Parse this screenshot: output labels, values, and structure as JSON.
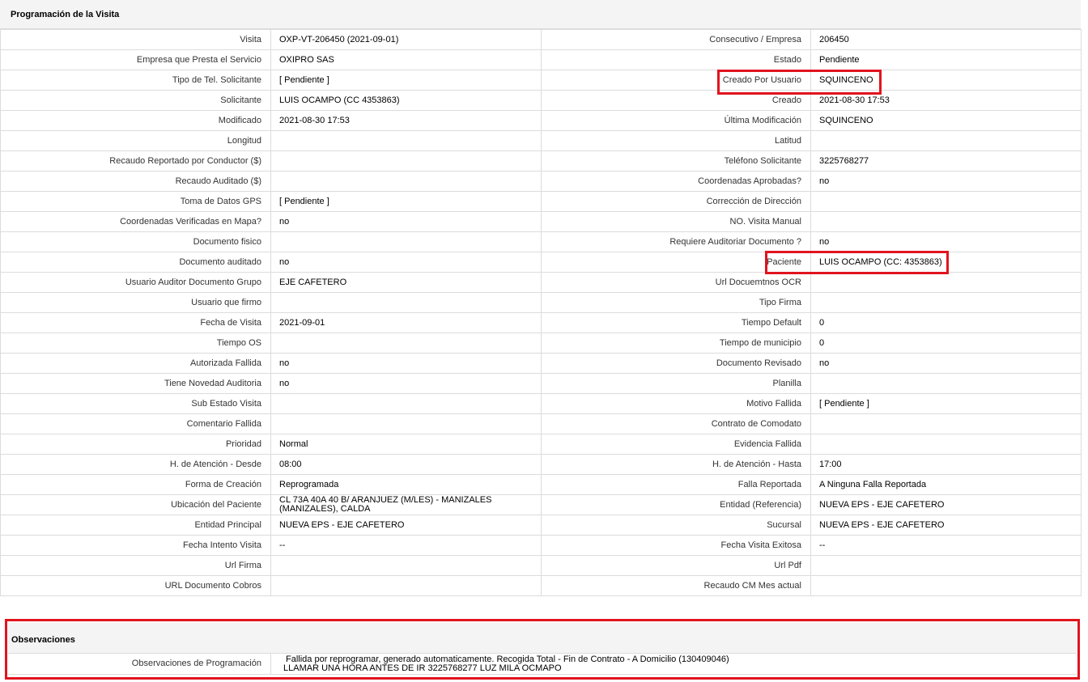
{
  "panel_title": "Programación de la Visita",
  "rows": [
    {
      "l1": "Visita",
      "v1": "OXP-VT-206450 (2021-09-01)",
      "l2": "Consecutivo / Empresa",
      "v2": "206450"
    },
    {
      "l1": "Empresa que Presta el Servicio",
      "v1": "OXIPRO SAS",
      "l2": "Estado",
      "v2": "Pendiente"
    },
    {
      "l1": "Tipo de Tel. Solicitante",
      "v1": "[ Pendiente ]",
      "l2": "Creado Por Usuario",
      "v2": "SQUINCENO"
    },
    {
      "l1": "Solicitante",
      "v1": "LUIS OCAMPO (CC 4353863)",
      "l2": "Creado",
      "v2": "2021-08-30 17:53"
    },
    {
      "l1": "Modificado",
      "v1": "2021-08-30 17:53",
      "l2": "Última Modificación",
      "v2": " SQUINCENO"
    },
    {
      "l1": "Longitud",
      "v1": "",
      "l2": "Latitud",
      "v2": ""
    },
    {
      "l1": "Recaudo Reportado por Conductor ($)",
      "v1": "",
      "l2": "Teléfono Solicitante",
      "v2": "3225768277"
    },
    {
      "l1": "Recaudo Auditado ($)",
      "v1": "",
      "l2": "Coordenadas Aprobadas?",
      "v2": " no"
    },
    {
      "l1": "Toma de Datos GPS",
      "v1": "[ Pendiente ]",
      "l2": "Corrección de Dirección",
      "v2": ""
    },
    {
      "l1": "Coordenadas Verificadas en Mapa?",
      "v1": " no",
      "l2": "NO. Visita Manual",
      "v2": ""
    },
    {
      "l1": "Documento fisico",
      "v1": "",
      "l2": "Requiere Auditoriar Documento ?",
      "v2": " no"
    },
    {
      "l1": "Documento auditado",
      "v1": " no",
      "l2": "Paciente",
      "v2": "LUIS OCAMPO (CC: 4353863)"
    },
    {
      "l1": "Usuario Auditor Documento Grupo",
      "v1": "EJE CAFETERO",
      "l2": "Url Docuemtnos OCR",
      "v2": ""
    },
    {
      "l1": "Usuario que firmo",
      "v1": "",
      "l2": "Tipo Firma",
      "v2": ""
    },
    {
      "l1": "Fecha de Visita",
      "v1": " 2021-09-01",
      "l2": "Tiempo Default",
      "v2": "0"
    },
    {
      "l1": "Tiempo OS",
      "v1": "",
      "l2": "Tiempo de municipio",
      "v2": "0"
    },
    {
      "l1": "Autorizada Fallida",
      "v1": " no",
      "l2": "Documento Revisado",
      "v2": " no"
    },
    {
      "l1": "Tiene Novedad Auditoria",
      "v1": " no",
      "l2": "Planilla",
      "v2": ""
    },
    {
      "l1": "Sub Estado Visita",
      "v1": "",
      "l2": "Motivo Fallida",
      "v2": "[ Pendiente ]"
    },
    {
      "l1": "Comentario Fallida",
      "v1": "",
      "l2": "Contrato de Comodato",
      "v2": ""
    },
    {
      "l1": "Prioridad",
      "v1": "Normal",
      "l2": "Evidencia Fallida",
      "v2": ""
    },
    {
      "l1": "H. de Atención - Desde",
      "v1": "08:00",
      "l2": "H. de Atención - Hasta",
      "v2": "17:00"
    },
    {
      "l1": "Forma de Creación",
      "v1": "Reprogramada",
      "l2": "Falla Reportada",
      "v2": "A Ninguna Falla Reportada"
    },
    {
      "l1": "Ubicación del Paciente",
      "v1": "CL 73A 40A 40 B/ ARANJUEZ (M/LES) - MANIZALES (MANIZALES), CALDA",
      "l2": "Entidad (Referencia)",
      "v2": "NUEVA EPS - EJE CAFETERO"
    },
    {
      "l1": "Entidad Principal",
      "v1": "NUEVA EPS - EJE CAFETERO",
      "l2": "Sucursal",
      "v2": "NUEVA EPS - EJE CAFETERO"
    },
    {
      "l1": "Fecha Intento Visita",
      "v1": " --",
      "l2": "Fecha Visita Exitosa",
      "v2": " --"
    },
    {
      "l1": "Url Firma",
      "v1": "",
      "l2": "Url Pdf",
      "v2": ""
    },
    {
      "l1": "URL Documento Cobros",
      "v1": "",
      "l2": "Recaudo CM Mes actual",
      "v2": ""
    }
  ],
  "observaciones": {
    "title": "Observaciones",
    "label": "Observaciones de Programación",
    "line1": "Fallida por reprogramar, generado automaticamente. Recogida Total - Fin de Contrato - A Domicilio (130409046)",
    "line2": "LLAMAR UNA HORA ANTES DE IR 3225768277 LUZ MILA OCMAPO"
  },
  "highlight_color": "#e0141e"
}
